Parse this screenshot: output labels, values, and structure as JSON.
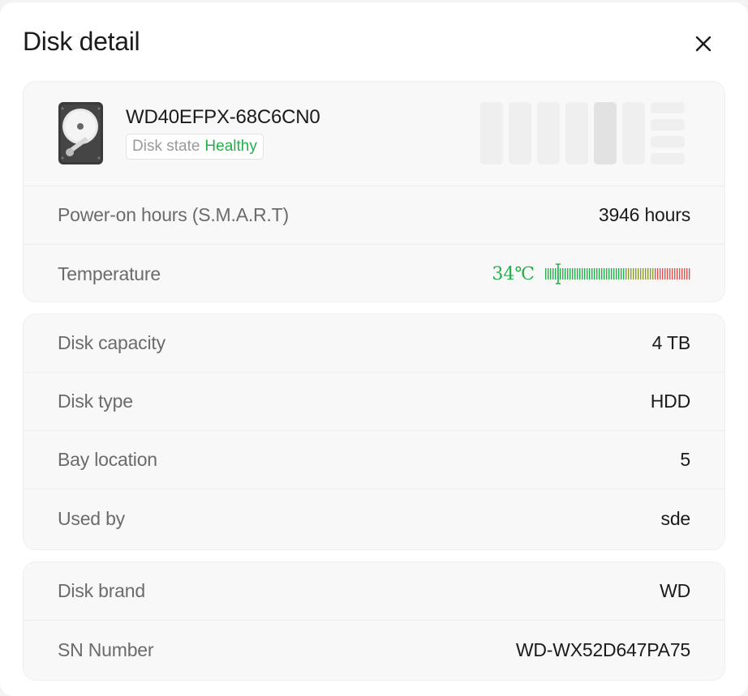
{
  "dialog": {
    "title": "Disk detail",
    "close_icon": "close-icon"
  },
  "disk": {
    "icon": "hard-drive-icon",
    "model": "WD40EFPX-68C6CN0",
    "state_label": "Disk state",
    "state_value": "Healthy",
    "state_color": "#22b04b",
    "bays_icon": "nas-bays-icon",
    "selected_bay": 5
  },
  "stats": {
    "power_on_label": "Power-on hours (S.M.A.R.T)",
    "power_on_value": "3946 hours",
    "temperature_label": "Temperature",
    "temperature_value": "34℃",
    "temperature_level": 0.09
  },
  "info": {
    "capacity_label": "Disk capacity",
    "capacity_value": "4 TB",
    "type_label": "Disk type",
    "type_value": "HDD",
    "bay_label": "Bay location",
    "bay_value": "5",
    "used_label": "Used by",
    "used_value": "sde"
  },
  "brand": {
    "brand_label": "Disk brand",
    "brand_value": "WD",
    "sn_label": "SN Number",
    "sn_value": "WD-WX52D647PA75"
  },
  "colors": {
    "healthy": "#22b04b",
    "temp_warm": "#8c9a2a",
    "temp_hot": "#d9534f"
  }
}
